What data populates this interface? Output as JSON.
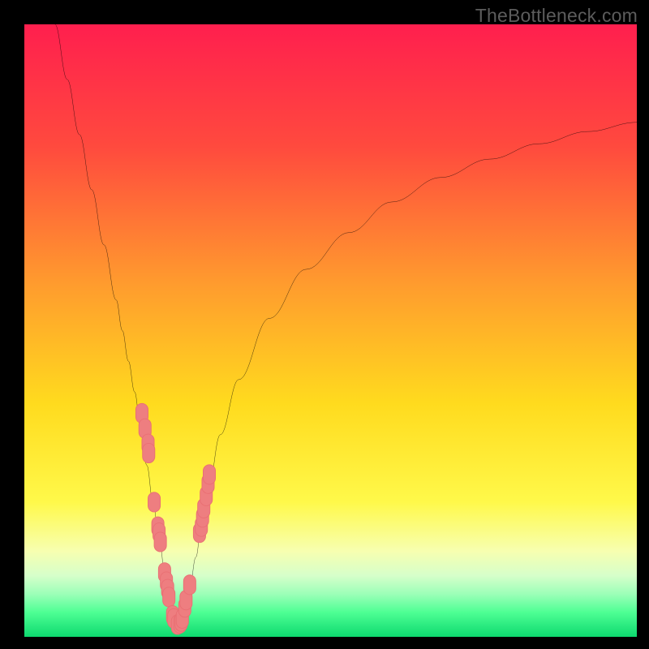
{
  "watermark": "TheBottleneck.com",
  "colors": {
    "gradient_stops": [
      {
        "offset": 0.0,
        "color": "#ff1f4e"
      },
      {
        "offset": 0.2,
        "color": "#ff4a3e"
      },
      {
        "offset": 0.42,
        "color": "#ff9a2e"
      },
      {
        "offset": 0.62,
        "color": "#ffdb1e"
      },
      {
        "offset": 0.78,
        "color": "#fff94a"
      },
      {
        "offset": 0.86,
        "color": "#f7ffb0"
      },
      {
        "offset": 0.9,
        "color": "#d6ffca"
      },
      {
        "offset": 0.93,
        "color": "#9cffb8"
      },
      {
        "offset": 0.96,
        "color": "#4eff94"
      },
      {
        "offset": 1.0,
        "color": "#0dd96f"
      }
    ],
    "curve": "#000000",
    "marker_fill": "#ee7e80",
    "marker_stroke": "#e96f73"
  },
  "chart_data": {
    "type": "line",
    "title": "",
    "xlabel": "",
    "ylabel": "",
    "xlim": [
      0,
      100
    ],
    "ylim": [
      0,
      100
    ],
    "series": [
      {
        "name": "left-branch",
        "x": [
          5,
          7,
          9,
          11,
          13,
          15,
          16,
          17,
          18,
          19,
          20,
          21,
          22,
          23,
          23.5,
          24,
          24.5,
          25
        ],
        "y": [
          100,
          91,
          82,
          73,
          64,
          55,
          50,
          45,
          40,
          34,
          28,
          22,
          16,
          10,
          7,
          5,
          3,
          2
        ]
      },
      {
        "name": "right-branch",
        "x": [
          25,
          26,
          27,
          28,
          29,
          30,
          32,
          35,
          40,
          46,
          53,
          60,
          68,
          76,
          84,
          92,
          100
        ],
        "y": [
          2,
          4,
          8,
          13,
          19,
          24,
          33,
          42,
          52,
          60,
          66,
          71,
          75,
          78,
          80.5,
          82.5,
          84
        ]
      }
    ],
    "markers": [
      {
        "x": 19.2,
        "y": 36.5
      },
      {
        "x": 19.7,
        "y": 34.0
      },
      {
        "x": 20.2,
        "y": 31.5
      },
      {
        "x": 20.3,
        "y": 30.0
      },
      {
        "x": 21.2,
        "y": 22.0
      },
      {
        "x": 21.8,
        "y": 18.0
      },
      {
        "x": 22.0,
        "y": 17.0
      },
      {
        "x": 22.2,
        "y": 15.5
      },
      {
        "x": 22.9,
        "y": 10.5
      },
      {
        "x": 23.2,
        "y": 9.0
      },
      {
        "x": 23.4,
        "y": 7.8
      },
      {
        "x": 23.6,
        "y": 6.5
      },
      {
        "x": 24.2,
        "y": 3.5
      },
      {
        "x": 24.4,
        "y": 3.0
      },
      {
        "x": 25.0,
        "y": 2.0
      },
      {
        "x": 25.4,
        "y": 2.2
      },
      {
        "x": 25.6,
        "y": 2.5
      },
      {
        "x": 25.8,
        "y": 3.0
      },
      {
        "x": 26.2,
        "y": 4.8
      },
      {
        "x": 26.4,
        "y": 6.0
      },
      {
        "x": 27.0,
        "y": 8.5
      },
      {
        "x": 28.6,
        "y": 17.0
      },
      {
        "x": 28.9,
        "y": 18.0
      },
      {
        "x": 29.1,
        "y": 19.5
      },
      {
        "x": 29.3,
        "y": 21.0
      },
      {
        "x": 29.7,
        "y": 23.0
      },
      {
        "x": 30.0,
        "y": 25.0
      },
      {
        "x": 30.2,
        "y": 26.5
      }
    ]
  }
}
